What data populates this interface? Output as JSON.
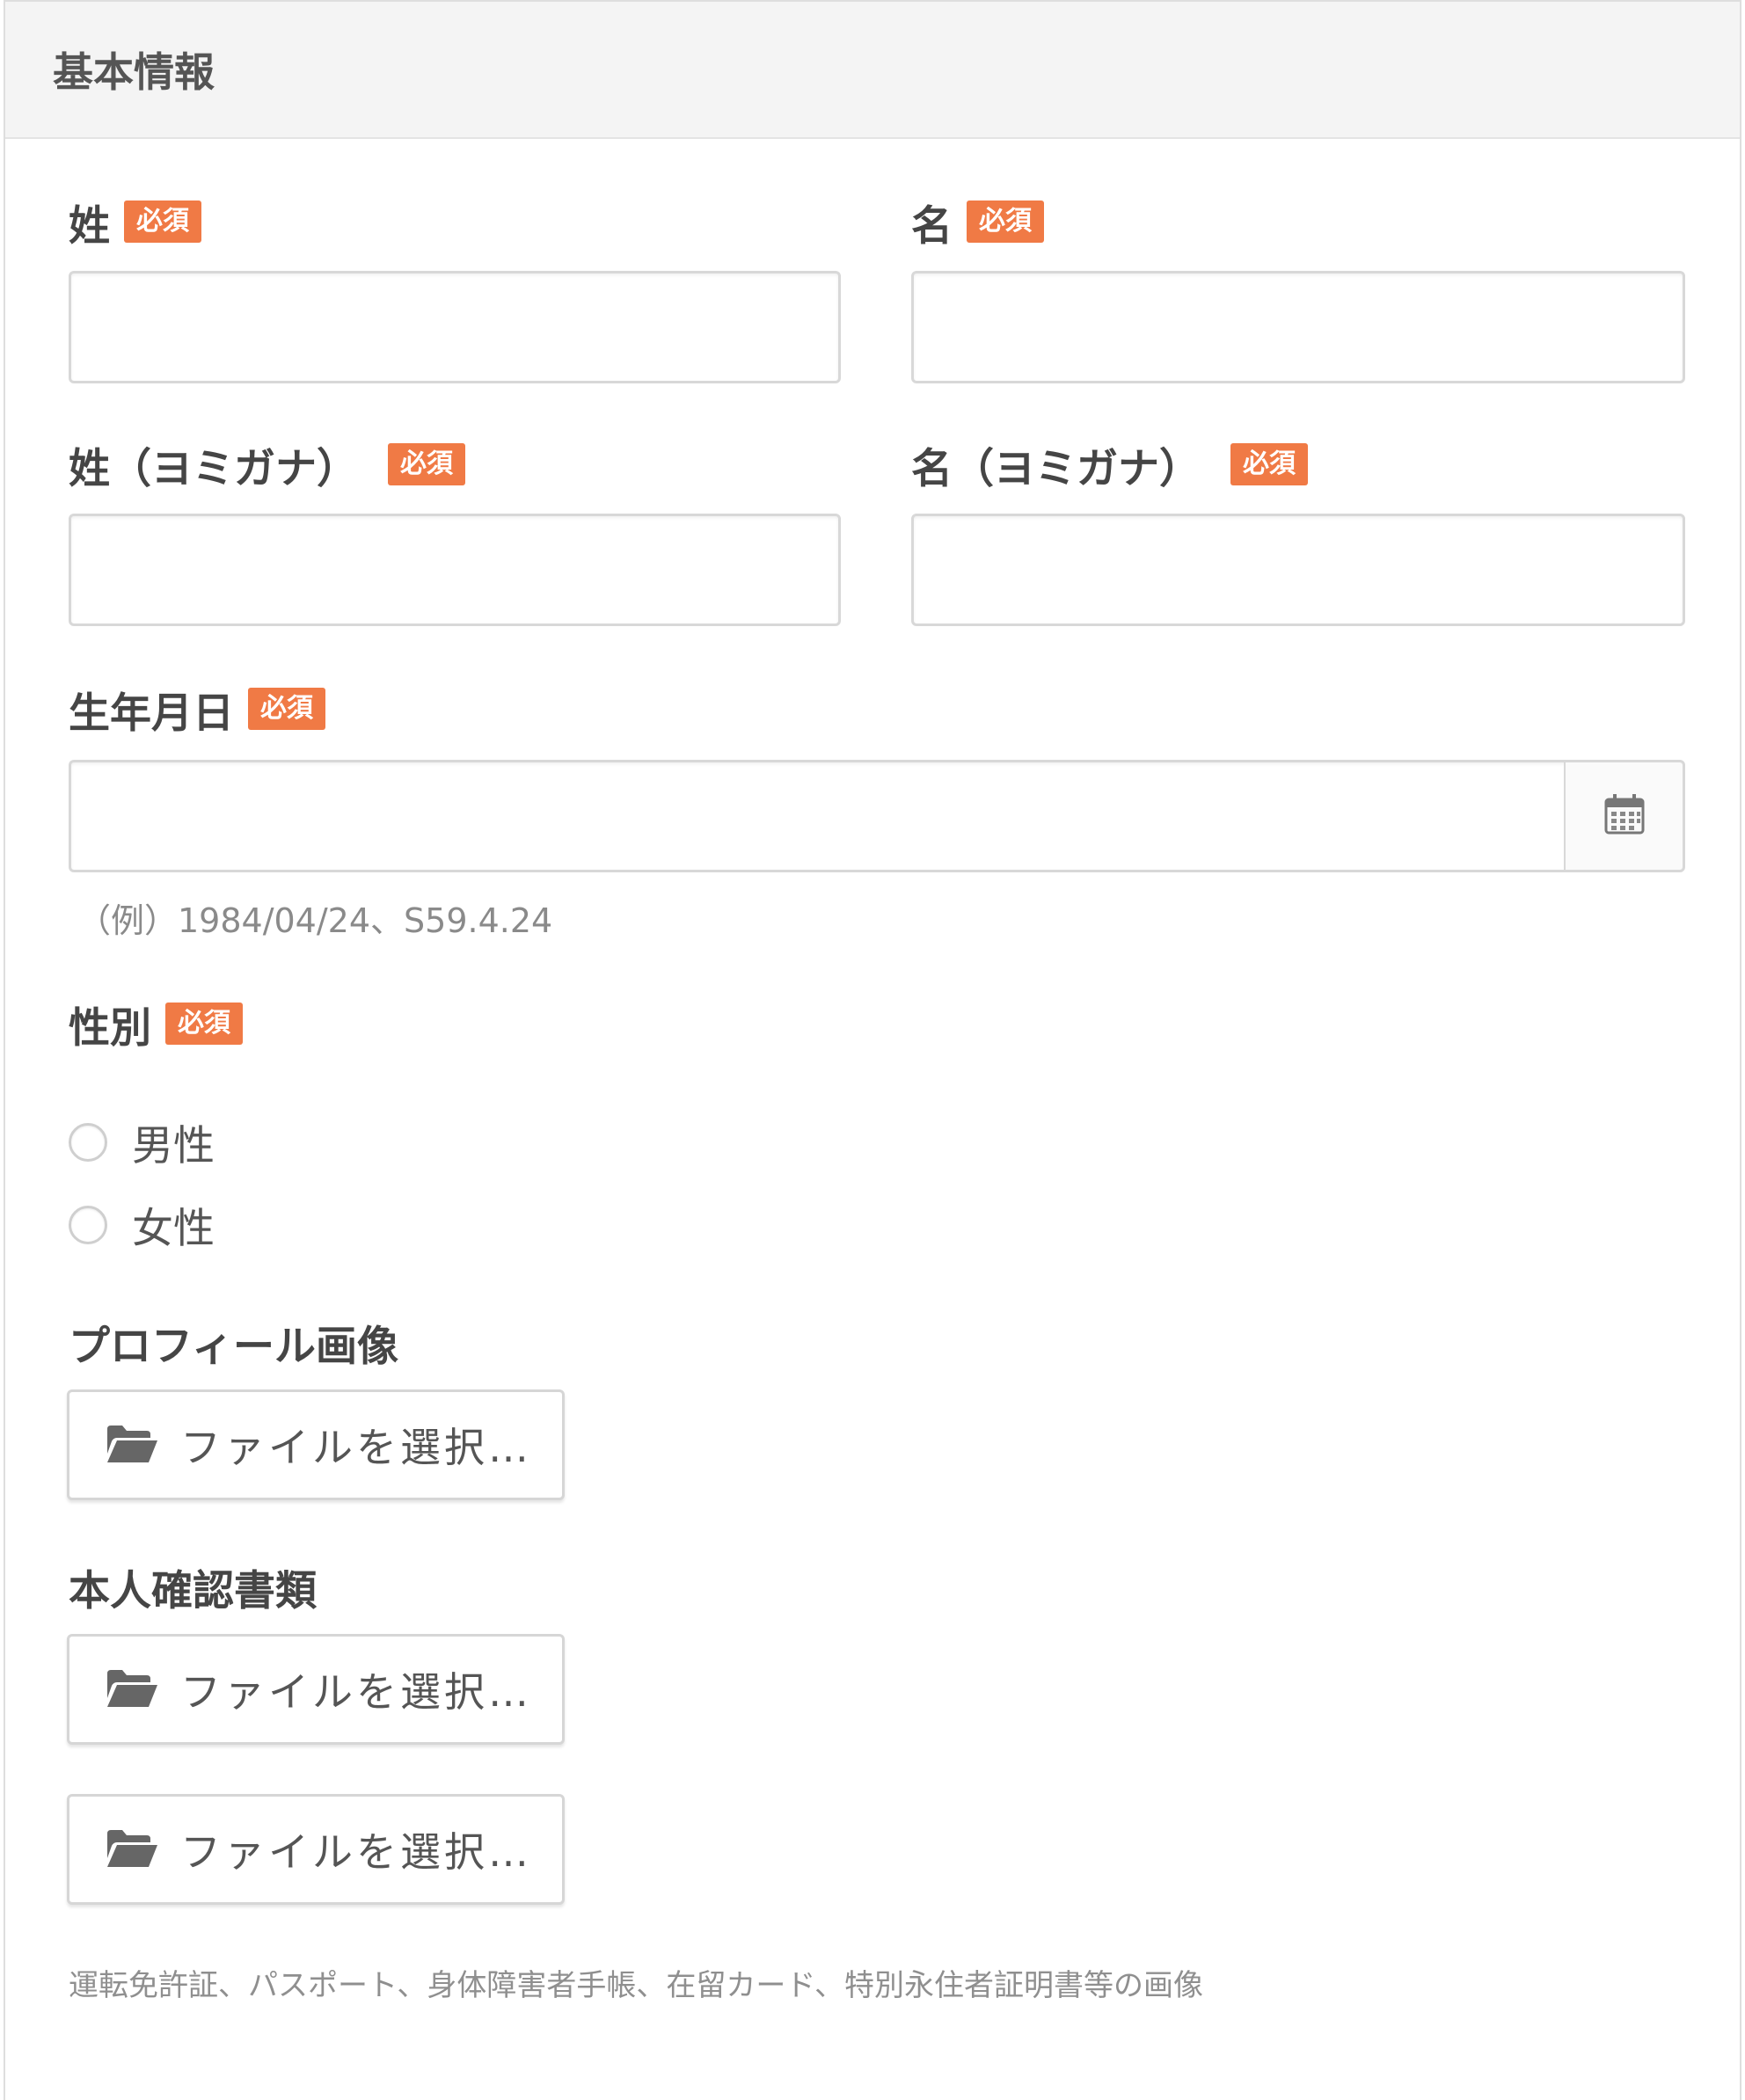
{
  "panel": {
    "title": "基本情報"
  },
  "required_badge": "必須",
  "fields": {
    "last_name": {
      "label": "姓",
      "value": ""
    },
    "first_name": {
      "label": "名",
      "value": ""
    },
    "last_name_kana": {
      "label": "姓（ヨミガナ）",
      "value": ""
    },
    "first_name_kana": {
      "label": "名（ヨミガナ）",
      "value": ""
    },
    "birthdate": {
      "label": "生年月日",
      "value": "",
      "hint": "（例）1984/04/24、S59.4.24"
    }
  },
  "gender": {
    "label": "性別",
    "options": [
      {
        "label": "男性",
        "checked": false
      },
      {
        "label": "女性",
        "checked": false
      }
    ]
  },
  "profile_image": {
    "label": "プロフィール画像",
    "button": "ファイルを選択…"
  },
  "identity_docs": {
    "label": "本人確認書類",
    "buttons": [
      "ファイルを選択…",
      "ファイルを選択…"
    ],
    "note": "運転免許証、パスポート、身体障害者手帳、在留カード、特別永住者証明書等の画像"
  },
  "icons": {
    "calendar": "calendar-icon",
    "folder": "folder-open-icon"
  },
  "colors": {
    "badge": "#f07a45",
    "header_bg": "#f4f4f4",
    "border": "#d8d8d8"
  }
}
